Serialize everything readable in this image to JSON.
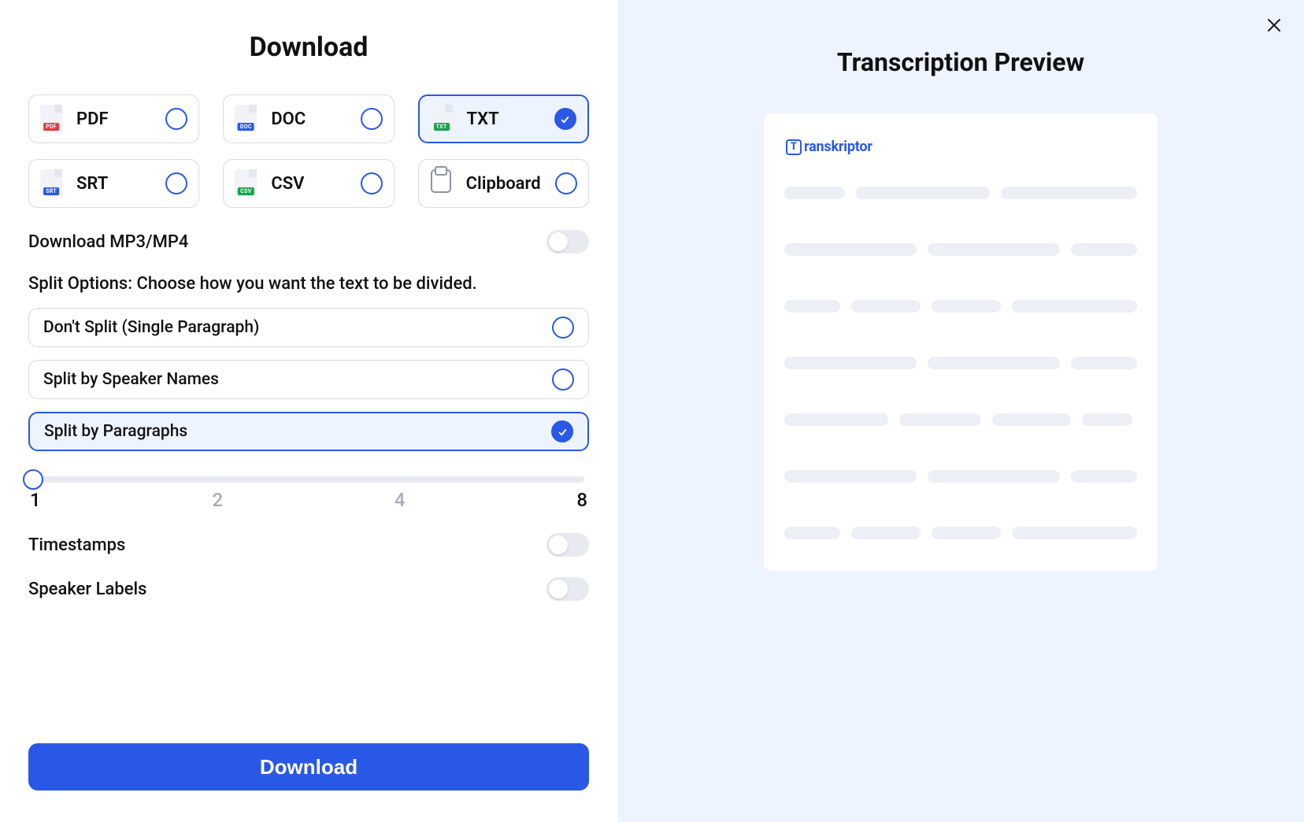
{
  "title": "Download",
  "formats": [
    {
      "label": "PDF",
      "tag": "PDF",
      "selected": false,
      "tagClass": "tag-pdf"
    },
    {
      "label": "DOC",
      "tag": "DOC",
      "selected": false,
      "tagClass": "tag-doc"
    },
    {
      "label": "TXT",
      "tag": "TXT",
      "selected": true,
      "tagClass": "tag-txt"
    },
    {
      "label": "SRT",
      "tag": "SRT",
      "selected": false,
      "tagClass": "tag-srt"
    },
    {
      "label": "CSV",
      "tag": "CSV",
      "selected": false,
      "tagClass": "tag-csv"
    },
    {
      "label": "Clipboard",
      "tag": "",
      "selected": false,
      "tagClass": ""
    }
  ],
  "toggles": {
    "download_media": {
      "label": "Download MP3/MP4",
      "value": false
    },
    "timestamps": {
      "label": "Timestamps",
      "value": false
    },
    "speaker_labels": {
      "label": "Speaker Labels",
      "value": false
    }
  },
  "split_section_label": "Split Options: Choose how you want the text to be divided.",
  "split_options": [
    {
      "label": "Don't Split (Single Paragraph)",
      "selected": false
    },
    {
      "label": "Split by Speaker Names",
      "selected": false
    },
    {
      "label": "Split by Paragraphs",
      "selected": true
    }
  ],
  "slider": {
    "min": 1,
    "mid1": 2,
    "mid2": 4,
    "max": 8,
    "value": 1
  },
  "download_button_label": "Download",
  "preview": {
    "title": "Transcription Preview",
    "brand_letter": "T",
    "brand_rest": "ranskriptor"
  }
}
